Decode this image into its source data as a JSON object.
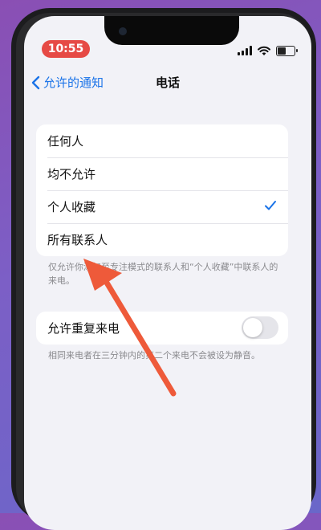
{
  "status_bar": {
    "time": "10:55"
  },
  "nav": {
    "back_label": "允许的通知",
    "title": "电话"
  },
  "options": [
    {
      "label": "任何人",
      "selected": false
    },
    {
      "label": "均不允许",
      "selected": false
    },
    {
      "label": "个人收藏",
      "selected": true
    },
    {
      "label": "所有联系人",
      "selected": false
    }
  ],
  "options_footnote": "仅允许你添加至专注模式的联系人和“个人收藏”中联系人的来电。",
  "repeat_calls": {
    "label": "允许重复来电",
    "enabled": false
  },
  "repeat_footnote": "相同来电者在三分钟内的第二个来电不会被设为静音。",
  "colors": {
    "accent": "#1a73e8",
    "annotation_arrow": "#ee5a3a",
    "time_pill": "#e64a45"
  }
}
